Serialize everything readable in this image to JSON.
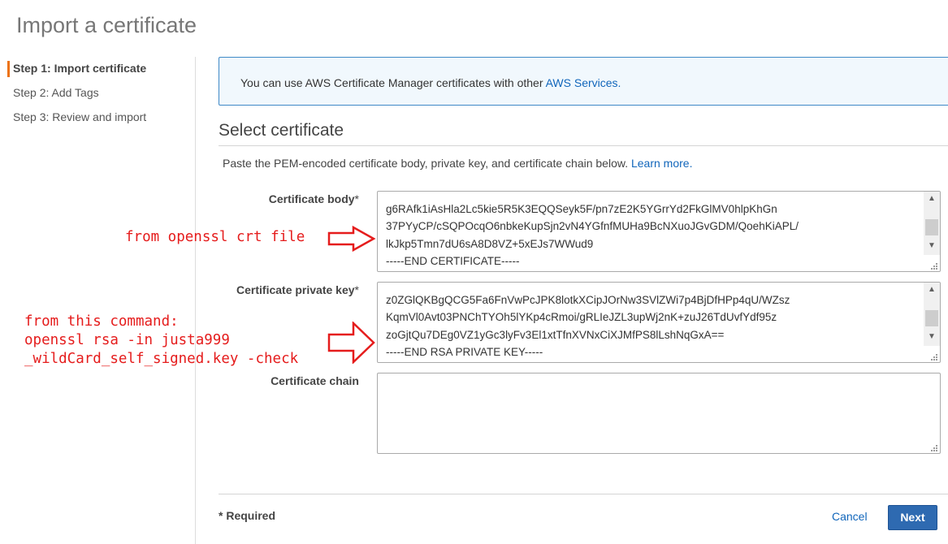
{
  "page": {
    "title": "Import a certificate"
  },
  "sidebar": {
    "steps": [
      {
        "label": "Step 1: Import certificate"
      },
      {
        "label": "Step 2: Add Tags"
      },
      {
        "label": "Step 3: Review and import"
      }
    ]
  },
  "info": {
    "text": "You can use AWS Certificate Manager certificates with other ",
    "link": "AWS Services."
  },
  "section": {
    "title": "Select certificate",
    "instructions": "Paste the PEM-encoded certificate body, private key, and certificate chain below. ",
    "learn_more": "Learn more."
  },
  "fields": {
    "certificate_body": {
      "label": "Certificate body",
      "required_mark": "*",
      "lines": [
        "g6RAfk1iAsHla2Lc5kie5R5K3EQQSeyk5F/pn7zE2K5YGrrYd2FkGlMV0hlpKhGn",
        "37PYyCP/cSQPOcqO6nbkeKupSjn2vN4YGfnfMUHa9BcNXuoJGvGDM/QoehKiAPL/",
        "lkJkp5Tmn7dU6sA8D8VZ+5xEJs7WWud9",
        "-----END CERTIFICATE-----"
      ]
    },
    "private_key": {
      "label": "Certificate private key",
      "required_mark": "*",
      "lines": [
        "z0ZGlQKBgQCG5Fa6FnVwPcJPK8lotkXCipJOrNw3SVlZWi7p4BjDfHPp4qU/WZsz",
        "KqmVl0Avt03PNChTYOh5lYKp4cRmoi/gRLIeJZL3upWj2nK+zuJ26TdUvfYdf95z",
        "zoGjtQu7DEg0VZ1yGc3lyFv3El1xtTfnXVNxCiXJMfPS8lLshNqGxA==",
        "-----END RSA PRIVATE KEY-----"
      ]
    },
    "certificate_chain": {
      "label": "Certificate chain",
      "value": ""
    }
  },
  "annotations": {
    "crt": [
      "from openssl crt file"
    ],
    "key": [
      "from this command:",
      "openssl rsa -in justa999",
      "_wildCard_self_signed.key -check"
    ]
  },
  "footer": {
    "required": "* Required",
    "cancel": "Cancel",
    "next": "Next"
  },
  "colors": {
    "accent": "#ec7211",
    "link": "#1166bb",
    "primary_button": "#2e6ab1",
    "info_border": "#3f89c7",
    "info_background": "#f1f8fd",
    "annotation": "#e51c1c"
  },
  "icons": [
    "scroll-up-icon",
    "scroll-down-icon",
    "resize-grip-icon",
    "red-arrow-icon"
  ]
}
